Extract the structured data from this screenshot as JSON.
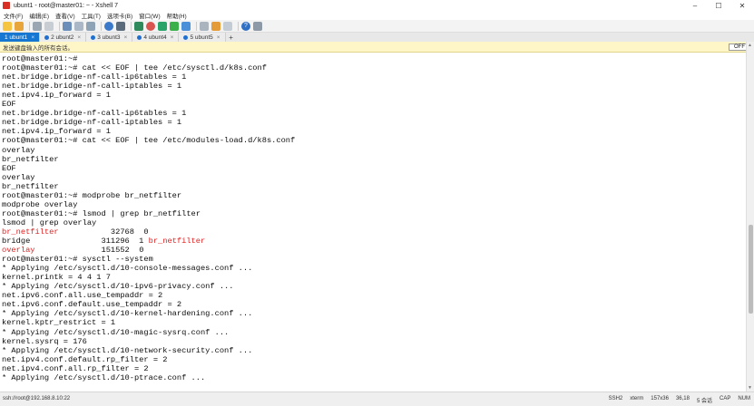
{
  "window": {
    "title": "ubunt1 - root@master01: ~ - Xshell 7",
    "buttons": {
      "minimize": "–",
      "maximize": "☐",
      "close": "✕"
    }
  },
  "menu": [
    "文件(F)",
    "编辑(E)",
    "查看(V)",
    "工具(T)",
    "选项卡(B)",
    "窗口(W)",
    "帮助(H)"
  ],
  "tabs": [
    {
      "label": "1 ubunt1",
      "active": true
    },
    {
      "label": "2 ubunt2",
      "active": false
    },
    {
      "label": "3 ubunt3",
      "active": false
    },
    {
      "label": "4 ubunt4",
      "active": false
    },
    {
      "label": "5 ubunt5",
      "active": false
    }
  ],
  "tab_add": "+",
  "send_bar": {
    "label": "发送键盘输入的所有会话。",
    "toggle": "OFF"
  },
  "terminal": {
    "lines": [
      [
        {
          "t": "root@master01:~#"
        }
      ],
      [
        {
          "t": "root@master01:~# cat << EOF | tee /etc/sysctl.d/k8s.conf"
        }
      ],
      [
        {
          "t": "net.bridge.bridge-nf-call-ip6tables = 1"
        }
      ],
      [
        {
          "t": "net.bridge.bridge-nf-call-iptables = 1"
        }
      ],
      [
        {
          "t": "net.ipv4.ip_forward = 1"
        }
      ],
      [
        {
          "t": "EOF"
        }
      ],
      [
        {
          "t": "net.bridge.bridge-nf-call-ip6tables = 1"
        }
      ],
      [
        {
          "t": "net.bridge.bridge-nf-call-iptables = 1"
        }
      ],
      [
        {
          "t": "net.ipv4.ip_forward = 1"
        }
      ],
      [
        {
          "t": "root@master01:~# cat << EOF | tee /etc/modules-load.d/k8s.conf"
        }
      ],
      [
        {
          "t": "overlay"
        }
      ],
      [
        {
          "t": "br_netfilter"
        }
      ],
      [
        {
          "t": "EOF"
        }
      ],
      [
        {
          "t": "overlay"
        }
      ],
      [
        {
          "t": "br_netfilter"
        }
      ],
      [
        {
          "t": "root@master01:~# modprobe br_netfilter"
        }
      ],
      [
        {
          "t": "modprobe overlay"
        }
      ],
      [
        {
          "t": "root@master01:~# lsmod | grep br_netfilter"
        }
      ],
      [
        {
          "t": "lsmod | grep overlay"
        }
      ],
      [
        {
          "t": "br_netfilter",
          "red": true
        },
        {
          "t": "           32768  0"
        }
      ],
      [
        {
          "t": "bridge               311296  1 "
        },
        {
          "t": "br_netfilter",
          "red": true
        }
      ],
      [
        {
          "t": "overlay",
          "red": true
        },
        {
          "t": "              151552  0"
        }
      ],
      [
        {
          "t": "root@master01:~# sysctl --system"
        }
      ],
      [
        {
          "t": "* Applying /etc/sysctl.d/10-console-messages.conf ..."
        }
      ],
      [
        {
          "t": "kernel.printk = 4 4 1 7"
        }
      ],
      [
        {
          "t": "* Applying /etc/sysctl.d/10-ipv6-privacy.conf ..."
        }
      ],
      [
        {
          "t": "net.ipv6.conf.all.use_tempaddr = 2"
        }
      ],
      [
        {
          "t": "net.ipv6.conf.default.use_tempaddr = 2"
        }
      ],
      [
        {
          "t": "* Applying /etc/sysctl.d/10-kernel-hardening.conf ..."
        }
      ],
      [
        {
          "t": "kernel.kptr_restrict = 1"
        }
      ],
      [
        {
          "t": "* Applying /etc/sysctl.d/10-magic-sysrq.conf ..."
        }
      ],
      [
        {
          "t": "kernel.sysrq = 176"
        }
      ],
      [
        {
          "t": "* Applying /etc/sysctl.d/10-network-security.conf ..."
        }
      ],
      [
        {
          "t": "net.ipv4.conf.default.rp_filter = 2"
        }
      ],
      [
        {
          "t": "net.ipv4.conf.all.rp_filter = 2"
        }
      ],
      [
        {
          "t": "* Applying /etc/sysctl.d/10-ptrace.conf ..."
        }
      ]
    ]
  },
  "status": {
    "connection": "ssh://root@192.168.8.10:22",
    "protocol": "SSH2",
    "terminal_type": "xterm",
    "size": "157x36",
    "cursor": "36,18",
    "sessions": "5 会话",
    "caps": "CAP",
    "num": "NUM"
  },
  "colors": {
    "accent": "#1677d2",
    "error_red": "#e02020",
    "send_bar": "#fff6c8"
  }
}
